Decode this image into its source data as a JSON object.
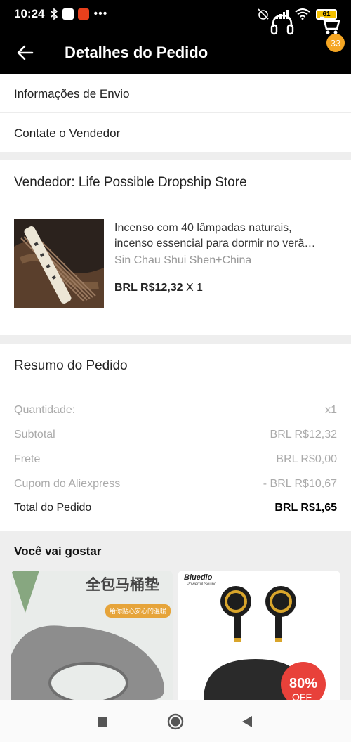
{
  "status_bar": {
    "time": "10:24",
    "battery": "61"
  },
  "header": {
    "title": "Detalhes do Pedido",
    "cart_count": "33"
  },
  "links": {
    "shipping_info": "Informações de Envio",
    "contact_seller": "Contate o Vendedor"
  },
  "seller": {
    "label": "Vendedor: Life Possible Dropship Store"
  },
  "product": {
    "name_line1": "Incenso com 40 lâmpadas naturais,",
    "name_line2": "incenso essencial para dormir no verã…",
    "variant": "Sin Chau Shui Shen+China",
    "price": "BRL R$12,32",
    "quantity": "X 1"
  },
  "summary": {
    "title": "Resumo do Pedido",
    "rows": [
      {
        "label": "Quantidade:",
        "value": "x1"
      },
      {
        "label": "Subtotal",
        "value": "BRL R$12,32"
      },
      {
        "label": "Frete",
        "value": "BRL R$0,00"
      },
      {
        "label": "Cupom do Aliexpress",
        "value": "- BRL R$10,67"
      }
    ],
    "total_label": "Total do Pedido",
    "total_value": "BRL R$1,65"
  },
  "recommendations": {
    "title": "Você vai gostar",
    "card1_text": "全包马桶垫",
    "card1_sub": "给你贴心安心的温暖",
    "card2_brand": "Bluedio",
    "card2_tagline": "Powerful Sound",
    "card2_badge": "80%",
    "card2_badge_sub": "OFF"
  },
  "colors": {
    "header_bg": "#000000",
    "badge": "#f5a623",
    "section_gap": "#eeeeee",
    "muted_text": "#aaaaaa"
  }
}
